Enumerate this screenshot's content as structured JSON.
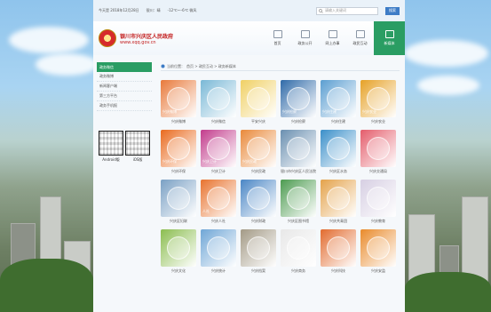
{
  "topbar": {
    "date": "今天是 2018年12月28日",
    "weather_label": "银川：晴",
    "temperature": "-12℃～-6℃ 微风",
    "search_placeholder": "请输入关键词",
    "search_button": "搜索"
  },
  "header": {
    "site_title": "银川市兴庆区人民政府",
    "site_url": "www.xqq.gov.cn",
    "nav": [
      {
        "label": "首页",
        "icon": "home-icon"
      },
      {
        "label": "政务公开",
        "icon": "document-icon"
      },
      {
        "label": "网上办事",
        "icon": "form-icon"
      },
      {
        "label": "政民互动",
        "icon": "chat-icon"
      },
      {
        "label": "新媒体",
        "icon": "media-icon"
      }
    ]
  },
  "sidebar": {
    "items": [
      "政务微信",
      "政务微博",
      "新闻客户端",
      "第三方平台",
      "政务手机报"
    ],
    "qr": [
      {
        "label": "Android版"
      },
      {
        "label": "iOS版"
      }
    ]
  },
  "breadcrumb": {
    "prefix": "当前位置：",
    "path": "首页 > 政民互动 > 政务新媒体"
  },
  "colors": {
    "accent": "#2a9d63",
    "brand": "#c21b1b",
    "link": "#3d7cc6"
  },
  "apps": [
    {
      "label": "兴庆微博",
      "tag": "兴庆微博",
      "color": "#e8793a"
    },
    {
      "label": "兴庆微信",
      "tag": "",
      "color": "#7ab8d6"
    },
    {
      "label": "平安兴庆",
      "tag": "",
      "color": "#f0d064"
    },
    {
      "label": "兴庆检察",
      "tag": "兴庆检察",
      "color": "#2f6aa8"
    },
    {
      "label": "兴庆住建",
      "tag": "兴庆住建",
      "color": "#5b9ed1"
    },
    {
      "label": "兴庆农业",
      "tag": "兴庆农业",
      "color": "#e6a126"
    },
    {
      "label": "兴庆环保",
      "tag": "兴庆环保",
      "color": "#e96a1e"
    },
    {
      "label": "兴庆卫计",
      "tag": "兴庆卫计",
      "color": "#c23c8c"
    },
    {
      "label": "兴庆民政",
      "tag": "兴庆民政",
      "color": "#e9893a"
    },
    {
      "label": "银川市兴庆区人民法院",
      "tag": "",
      "color": "#6a8fb0"
    },
    {
      "label": "兴庆区水务",
      "tag": "",
      "color": "#3a8fc9"
    },
    {
      "label": "兴庆交通局",
      "tag": "",
      "color": "#e45c6b"
    },
    {
      "label": "兴庆区妇联",
      "tag": "",
      "color": "#7aa0c4"
    },
    {
      "label": "兴庆人社",
      "tag": "人社",
      "color": "#e8732e"
    },
    {
      "label": "兴庆财政",
      "tag": "",
      "color": "#4a86c5"
    },
    {
      "label": "兴庆区图书馆",
      "tag": "",
      "color": "#4c9b50"
    },
    {
      "label": "兴庆共青团",
      "tag": "",
      "color": "#e4a24a"
    },
    {
      "label": "兴庆教育",
      "tag": "",
      "color": "#d7cfe3"
    },
    {
      "label": "兴庆文化",
      "tag": "",
      "color": "#8bbd4f"
    },
    {
      "label": "兴庆统计",
      "tag": "",
      "color": "#6fa6d6"
    },
    {
      "label": "兴庆档案",
      "tag": "",
      "color": "#a39a86"
    },
    {
      "label": "兴庆商务",
      "tag": "",
      "color": "#e8e8e8"
    },
    {
      "label": "兴庆科技",
      "tag": "",
      "color": "#e26b2e"
    },
    {
      "label": "兴庆安监",
      "tag": "",
      "color": "#e98a2a"
    }
  ]
}
